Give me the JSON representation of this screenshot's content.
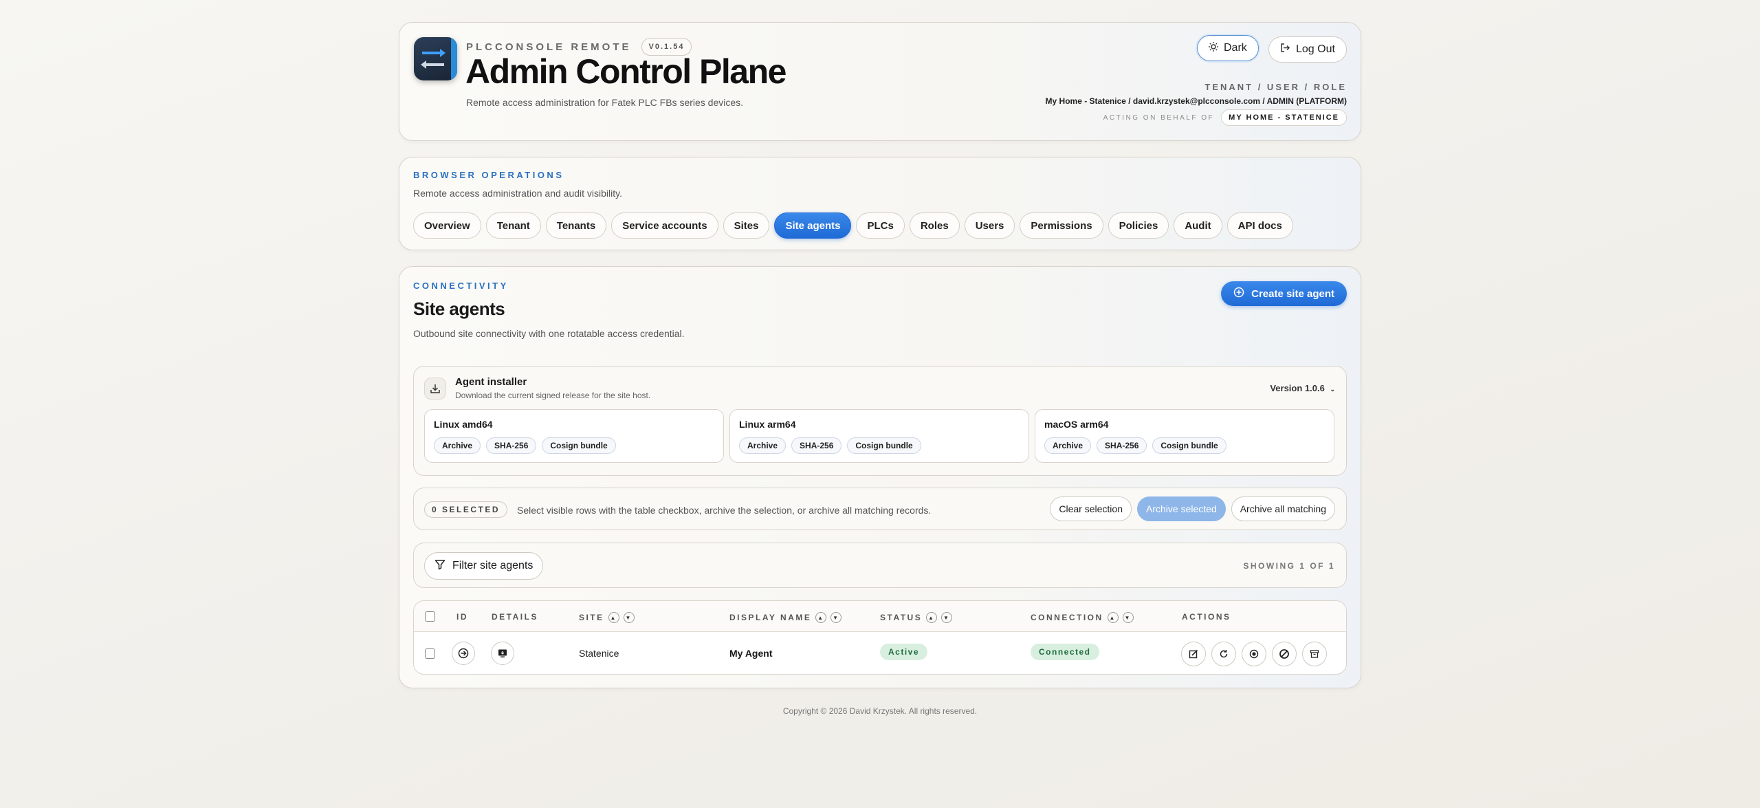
{
  "header": {
    "brand": "PLCCONSOLE REMOTE",
    "version": "V0.1.54",
    "title": "Admin Control Plane",
    "subtitle": "Remote access administration for Fatek PLC FBs series devices.",
    "theme_button": "Dark",
    "logout_button": "Log Out",
    "context_label": "TENANT / USER / ROLE",
    "context_value": "My Home - Statenice / david.krzystek@plcconsole.com / ADMIN (PLATFORM)",
    "acting_label": "ACTING ON BEHALF OF",
    "acting_value": "MY HOME - STATENICE"
  },
  "ops": {
    "eyebrow": "BROWSER OPERATIONS",
    "description": "Remote access administration and audit visibility.",
    "tabs": [
      {
        "label": "Overview"
      },
      {
        "label": "Tenant"
      },
      {
        "label": "Tenants"
      },
      {
        "label": "Service accounts"
      },
      {
        "label": "Sites"
      },
      {
        "label": "Site agents",
        "active": true
      },
      {
        "label": "PLCs"
      },
      {
        "label": "Roles"
      },
      {
        "label": "Users"
      },
      {
        "label": "Permissions"
      },
      {
        "label": "Policies"
      },
      {
        "label": "Audit"
      },
      {
        "label": "API docs"
      }
    ]
  },
  "main": {
    "eyebrow": "CONNECTIVITY",
    "title": "Site agents",
    "description": "Outbound site connectivity with one rotatable access credential.",
    "create_button": "Create site agent",
    "installer": {
      "title": "Agent installer",
      "description": "Download the current signed release for the site host.",
      "version": "Version 1.0.6",
      "platforms": [
        {
          "name": "Linux amd64",
          "links": [
            "Archive",
            "SHA-256",
            "Cosign bundle"
          ]
        },
        {
          "name": "Linux arm64",
          "links": [
            "Archive",
            "SHA-256",
            "Cosign bundle"
          ]
        },
        {
          "name": "macOS arm64",
          "links": [
            "Archive",
            "SHA-256",
            "Cosign bundle"
          ]
        }
      ]
    },
    "selection": {
      "count": "0 SELECTED",
      "hint": "Select visible rows with the table checkbox, archive the selection, or archive all matching records.",
      "clear": "Clear selection",
      "archive_selected": "Archive selected",
      "archive_all": "Archive all matching"
    },
    "filter": {
      "button": "Filter site agents",
      "showing": "SHOWING 1 OF 1"
    },
    "table": {
      "columns": [
        "ID",
        "DETAILS",
        "SITE",
        "DISPLAY NAME",
        "STATUS",
        "CONNECTION",
        "ACTIONS"
      ],
      "rows": [
        {
          "site": "Statenice",
          "display_name": "My Agent",
          "status": "Active",
          "connection": "Connected"
        }
      ]
    }
  },
  "footer": "Copyright © 2026 David Krzystek. All rights reserved.",
  "colors": {
    "accent": "#1f6ad6",
    "eyebrow": "#2a6fc1",
    "status_green": "#1f6b3f",
    "status_green_bg": "#d8efe0"
  }
}
